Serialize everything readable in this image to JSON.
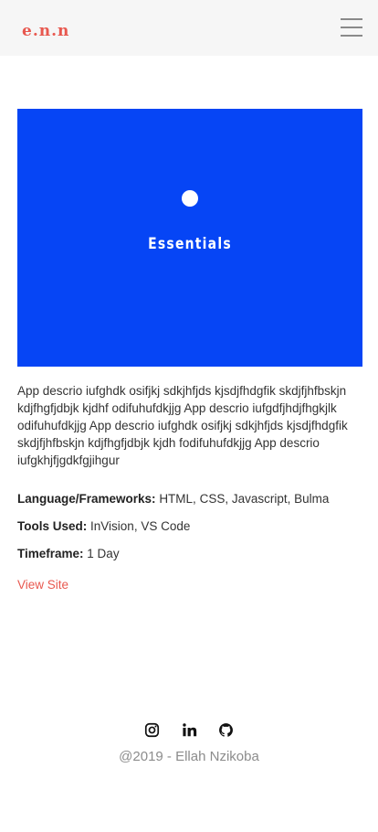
{
  "navbar": {
    "logo_text": "e.n.n",
    "menu_icon": "hamburger-menu-icon"
  },
  "project": {
    "title": "Essentials",
    "hero_color": "#0645f5",
    "description": "App descrio iufghdk osifjkj sdkjhfjds kjsdjfhdgfik skdjfjhfbskjn kdjfhgfjdbjk kjdhf odifuhufdkjjg App descrio iufgdfjhdjfhgkjlk odifuhufdkjjg App descrio iufghdk osifjkj sdkjhfjds kjsdjfhdgfik skdjfjhfbskjn kdjfhgfjdbjk kjdh fodifuhufdkjjg App descrio iufgkhjfjgdkfgjihgur",
    "meta": {
      "languages_label": "Language/Frameworks:",
      "languages_value": "HTML, CSS, Javascript, Bulma",
      "tools_label": "Tools Used:",
      "tools_value": "InVision, VS Code",
      "timeframe_label": "Timeframe:",
      "timeframe_value": "1 Day"
    },
    "view_site_label": "View Site",
    "accent_color": "#e8584f"
  },
  "footer": {
    "social_icons": [
      "instagram-icon",
      "linkedin-icon",
      "github-icon"
    ],
    "copyright": "@2019 - Ellah Nzikoba"
  }
}
